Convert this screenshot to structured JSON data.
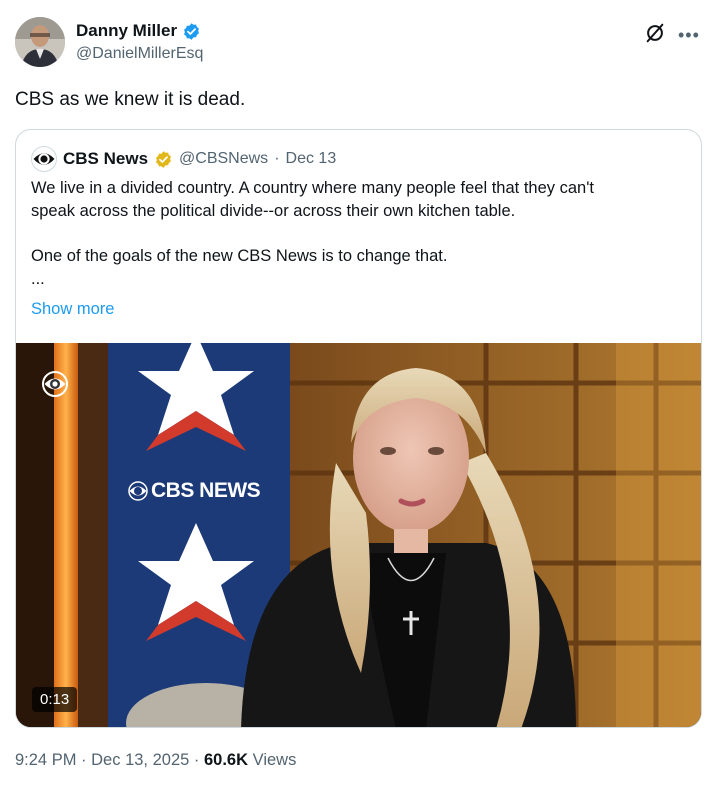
{
  "author": {
    "name": "Danny Miller",
    "handle": "@DanielMillerEsq",
    "verified_color": "#1d9bf0"
  },
  "tweet": {
    "text": "CBS as we knew it is dead."
  },
  "quote": {
    "name": "CBS News",
    "handle": "@CBSNews",
    "separator": "·",
    "date": "Dec 13",
    "verified_color": "#e2b719",
    "body_line1": "We live in a divided country. A country where many people feel that they can't",
    "body_line2": "speak across the political divide--or across their own kitchen table.",
    "body_line3": "One of the goals of the new CBS News is to change that.",
    "body_line4": "...",
    "show_more": "Show more",
    "media": {
      "duration": "0:13",
      "backdrop_text": "CBS NEWS"
    }
  },
  "footer": {
    "time": "9:24 PM",
    "sep1": "·",
    "date": "Dec 13, 2025",
    "sep2": "·",
    "views_count": "60.6K",
    "views_label": "Views"
  },
  "icons": {
    "grok": "grok-icon",
    "more": "more-icon",
    "cbs_logo": "cbs-eye-logo-icon"
  },
  "colors": {
    "accent": "#1d9bf0",
    "secondary_text": "#536471",
    "border": "#cfd9de"
  }
}
